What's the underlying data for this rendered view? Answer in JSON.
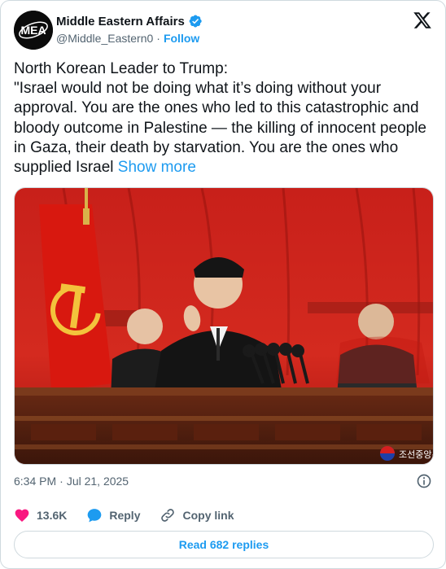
{
  "author": {
    "display_name": "Middle Eastern Affairs",
    "handle": "@Middle_Eastern0",
    "follow_label": "Follow",
    "avatar_text": "MEA",
    "verified": true
  },
  "tweet": {
    "text": "North Korean Leader to Trump:\n\"Israel would not be doing what it’s doing without your approval. You are the ones who led to this catastrophic and bloody outcome in Palestine — the killing of innocent people in Gaza, their death by starvation. You are the ones who supplied Israel ",
    "show_more": "Show more"
  },
  "media": {
    "watermark": "조선중앙통신"
  },
  "meta": {
    "time": "6:34 PM",
    "separator": "·",
    "date": "Jul 21, 2025"
  },
  "actions": {
    "likes": "13.6K",
    "reply": "Reply",
    "copy_link": "Copy link"
  },
  "footer": {
    "read_replies": "Read 682 replies"
  },
  "colors": {
    "accent": "#1d9bf0",
    "like": "#f91880",
    "text": "#0f1419",
    "muted": "#536471",
    "border": "#cfd9de"
  },
  "icons": [
    "verified-badge-icon",
    "x-logo-icon",
    "info-icon",
    "heart-icon",
    "reply-bubble-icon",
    "link-icon"
  ]
}
